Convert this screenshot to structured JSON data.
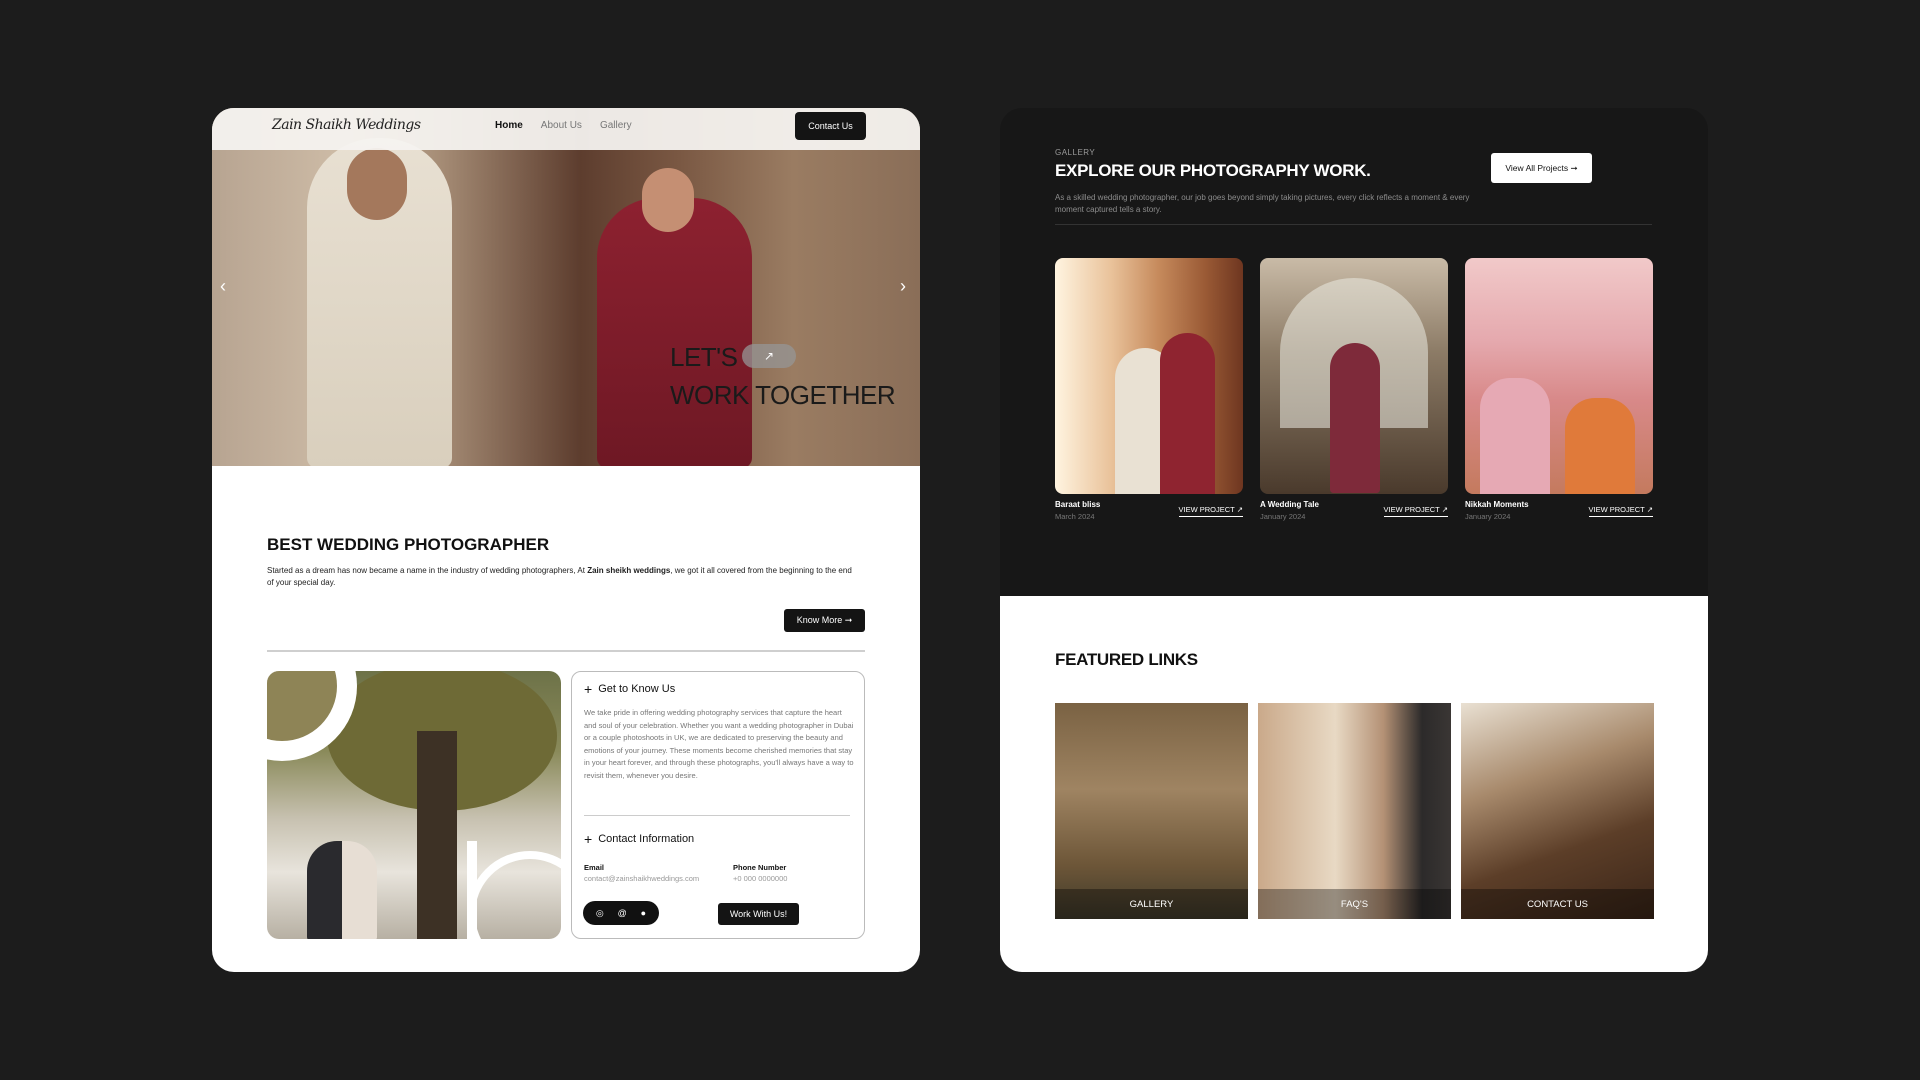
{
  "left": {
    "nav": {
      "logo": "Zain Shaikh Weddings",
      "links": [
        "Home",
        "About Us",
        "Gallery"
      ],
      "contact_label": "Contact Us"
    },
    "hero": {
      "line1": "LET'S",
      "line2": "WORK TOGETHER",
      "arrow_left": "‹",
      "arrow_right": "›",
      "pill_icon": "↗"
    },
    "about": {
      "heading": "BEST WEDDING PHOTOGRAPHER",
      "text_before": "Started as a dream has now became a name in the industry of wedding photographers, At ",
      "text_bold": "Zain sheikh weddings",
      "text_after": ", we got it all covered from the beginning to the end of your special day.",
      "button": "Know More ➞"
    },
    "info": {
      "know_heading": "Get to Know Us",
      "know_text": "We take pride in offering wedding photography services that capture the heart and soul of your celebration. Whether you want a wedding photographer in Dubai or a couple photoshoots in UK, we are dedicated to preserving the beauty and emotions of your journey. These moments become cherished memories that stay in your heart forever, and through these photographs, you'll always have a way to revisit them, whenever you desire.",
      "contact_heading": "Contact Information",
      "email_label": "Email",
      "email_value": "contact@zainshaikhweddings.com",
      "phone_label": "Phone Number",
      "phone_value": "+0 000 0000000",
      "social_icons": [
        "instagram-icon",
        "threads-icon",
        "facebook-icon"
      ],
      "work_button": "Work With Us!"
    }
  },
  "right": {
    "eyebrow": "GALLERY",
    "heading": "EXPLORE OUR PHOTOGRAPHY WORK.",
    "text": "As a skilled wedding photographer, our job goes beyond simply taking pictures, every click reflects a moment & every moment captured tells a story.",
    "view_all": "View All Projects ➞",
    "projects": [
      {
        "title": "Baraat bliss",
        "date": "March 2024",
        "link": "VIEW PROJECT ↗"
      },
      {
        "title": "A Wedding Tale",
        "date": "January 2024",
        "link": "VIEW PROJECT ↗"
      },
      {
        "title": "Nikkah Moments",
        "date": "January 2024",
        "link": "VIEW PROJECT ↗"
      }
    ],
    "featured_heading": "FEATURED LINKS",
    "featured": [
      "GALLERY",
      "FAQ'S",
      "CONTACT US"
    ]
  },
  "colors": {
    "page_bg": "#1c1c1c",
    "dark_panel": "#171717",
    "button_dark": "#141414",
    "white": "#ffffff"
  }
}
